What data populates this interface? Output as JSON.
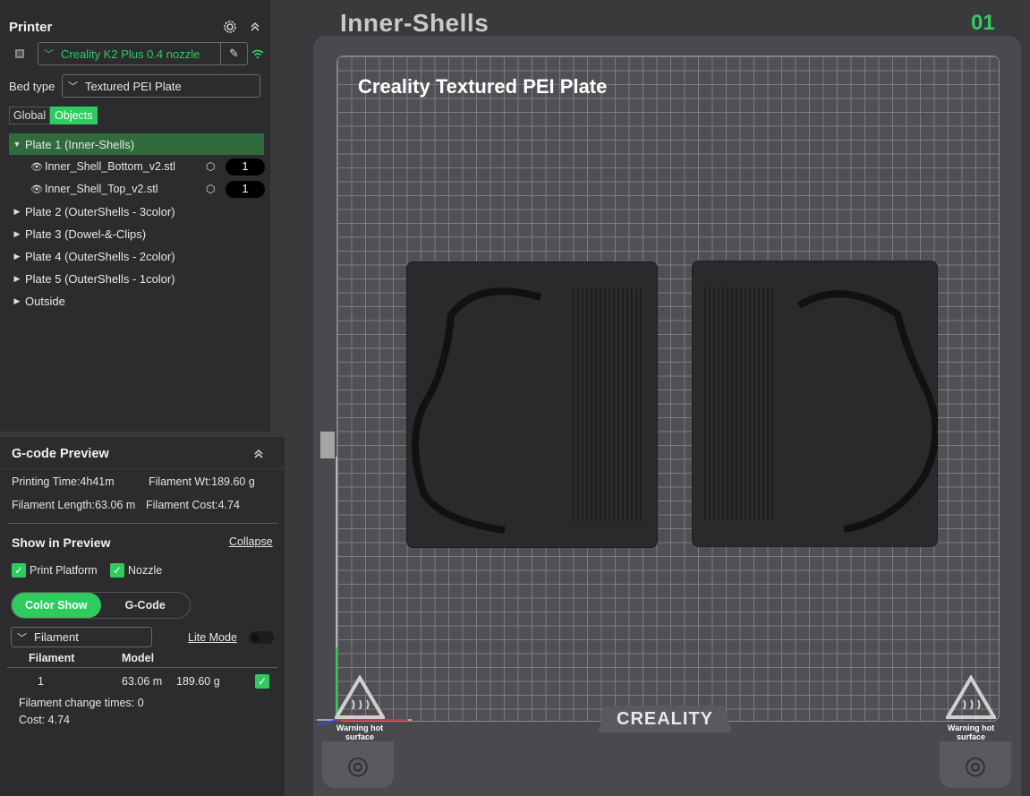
{
  "printer_panel": {
    "title": "Printer",
    "printer_name": "Creality K2 Plus 0.4 nozzle",
    "bed_type_label": "Bed type",
    "bed_type_value": "Textured PEI Plate",
    "tabs": [
      "Global",
      "Objects"
    ],
    "active_tab": "Objects",
    "tree": {
      "plates": [
        {
          "label": "Plate 1 (Inner-Shells)",
          "expanded": true,
          "selected": true,
          "children": [
            {
              "name": "Inner_Shell_Bottom_v2.stl",
              "count": "1"
            },
            {
              "name": "Inner_Shell_Top_v2.stl",
              "count": "1"
            }
          ]
        },
        {
          "label": "Plate 2 (OuterShells - 3color)"
        },
        {
          "label": "Plate 3 (Dowel-&-Clips)"
        },
        {
          "label": "Plate 4 (OuterShells - 2color)"
        },
        {
          "label": "Plate 5 (OuterShells - 1color)"
        },
        {
          "label": "Outside"
        }
      ]
    }
  },
  "gcode_preview": {
    "title": "G-code Preview",
    "printing_time": "Printing Time:4h41m",
    "filament_wt": "Filament Wt:189.60 g",
    "filament_length": "Filament Length:63.06 m",
    "filament_cost": "Filament Cost:4.74",
    "show_in_preview": "Show in Preview",
    "collapse": "Collapse",
    "print_platform": "Print Platform",
    "nozzle": "Nozzle",
    "color_show": "Color Show",
    "gcode_tab": "G-Code",
    "filament_dropdown": "Filament",
    "lite_mode": "Lite Mode",
    "table_headers": [
      "Filament",
      "Model"
    ],
    "table_row": {
      "filament": "1",
      "length": "63.06 m",
      "weight": "189.60 g"
    },
    "change_times": "Filament change times:  0",
    "cost": "Cost:  4.74"
  },
  "viewport": {
    "plate_name": "Inner-Shells",
    "plate_number": "01",
    "bed_label": "Creality Textured PEI Plate",
    "brand": "CREALITY",
    "warning_left": "Warning hot surface",
    "warning_right": "Warning hot surface"
  },
  "colors": {
    "accent": "#2ecc5f",
    "panel": "#2c2c2f",
    "background": "#3a3a3d"
  }
}
